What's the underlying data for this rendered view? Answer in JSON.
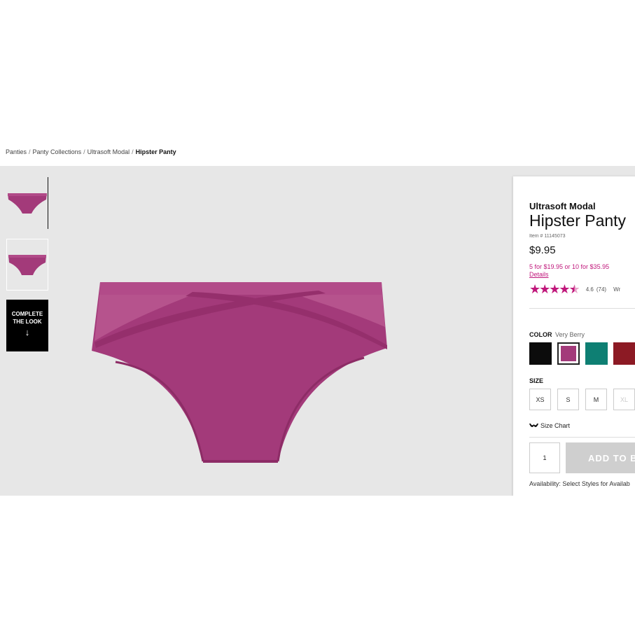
{
  "breadcrumb": {
    "items": [
      "Panties",
      "Panty Collections",
      "Ultrasoft Modal"
    ],
    "current": "Hipster Panty",
    "separator": "/"
  },
  "gallery": {
    "complete_line1": "COMPLETE",
    "complete_line2": "THE LOOK",
    "complete_arrow": "↓",
    "product_color": "#a33a7a"
  },
  "product": {
    "collection": "Ultrasoft Modal",
    "title": "Hipster Panty",
    "item_number": "Item # 11145073",
    "price": "$9.95",
    "promo": "5 for $19.95 or 10 for $35.95",
    "details_link": "Details",
    "rating": 4.6,
    "rating_text": "4.6",
    "review_count": "(74)",
    "write_review": "Wr"
  },
  "color": {
    "label": "COLOR",
    "selected_name": "Very Berry",
    "swatches": [
      {
        "name": "black",
        "hex": "#0c0c0c",
        "selected": false
      },
      {
        "name": "very-berry",
        "hex": "#a33a7a",
        "selected": true
      },
      {
        "name": "teal",
        "hex": "#0e7f73",
        "selected": false
      },
      {
        "name": "red",
        "hex": "#8c1a24",
        "selected": false
      }
    ]
  },
  "size": {
    "label": "SIZE",
    "options": [
      "XS",
      "S",
      "M",
      "XL"
    ],
    "size_chart": "Size Chart"
  },
  "cart": {
    "quantity": "1",
    "add_button": "ADD TO B",
    "availability": "Availability: Select Styles for Availab"
  },
  "colors": {
    "accent": "#c0177b",
    "stage_bg": "#e7e7e7"
  }
}
